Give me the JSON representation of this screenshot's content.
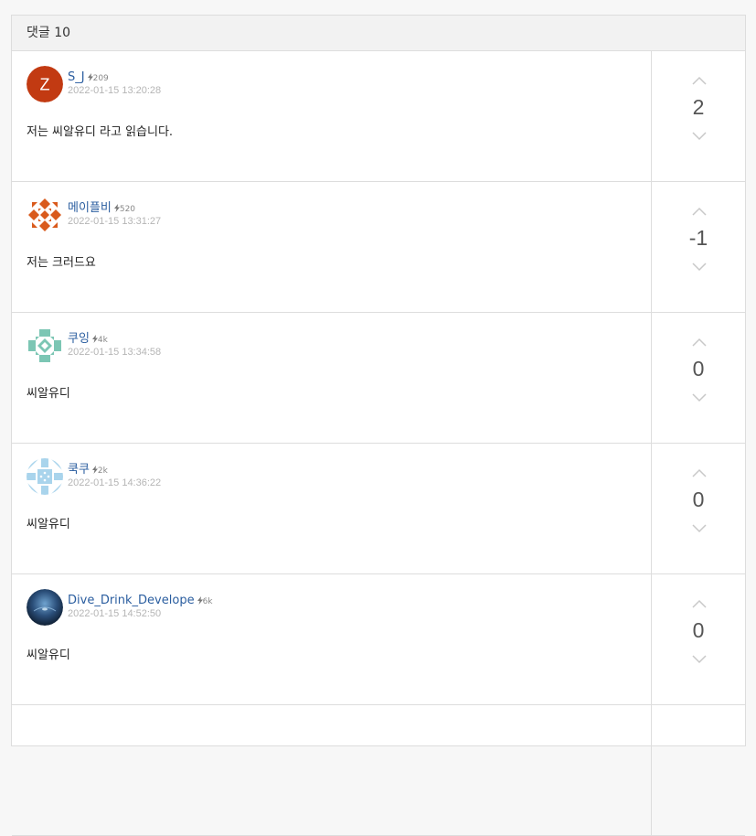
{
  "header": {
    "title": "댓글 10"
  },
  "comments": [
    {
      "author": "S_J",
      "reputation": "209",
      "timestamp": "2022-01-15 13:20:28",
      "content": "저는 씨알유디 라고 읽습니다.",
      "votes": "2",
      "avatar": {
        "type": "letter",
        "letter": "Z",
        "color": "#c23a12"
      }
    },
    {
      "author": "메이플비",
      "reputation": "520",
      "timestamp": "2022-01-15 13:31:27",
      "content": "저는 크러드요",
      "votes": "-1",
      "avatar": {
        "type": "pattern",
        "color": "#d95a1c"
      }
    },
    {
      "author": "쿠잉",
      "reputation": "4k",
      "timestamp": "2022-01-15 13:34:58",
      "content": "씨알유디",
      "votes": "0",
      "avatar": {
        "type": "pattern",
        "color": "#7cc6b4"
      }
    },
    {
      "author": "쿡쿠",
      "reputation": "2k",
      "timestamp": "2022-01-15 14:36:22",
      "content": "씨알유디",
      "votes": "0",
      "avatar": {
        "type": "pattern",
        "color": "#a9d4ec"
      }
    },
    {
      "author": "Dive_Drink_Develope",
      "reputation": "6k",
      "timestamp": "2022-01-15 14:52:50",
      "content": "씨알유디",
      "votes": "0",
      "avatar": {
        "type": "photo",
        "color": "#2b4f7a"
      }
    }
  ]
}
